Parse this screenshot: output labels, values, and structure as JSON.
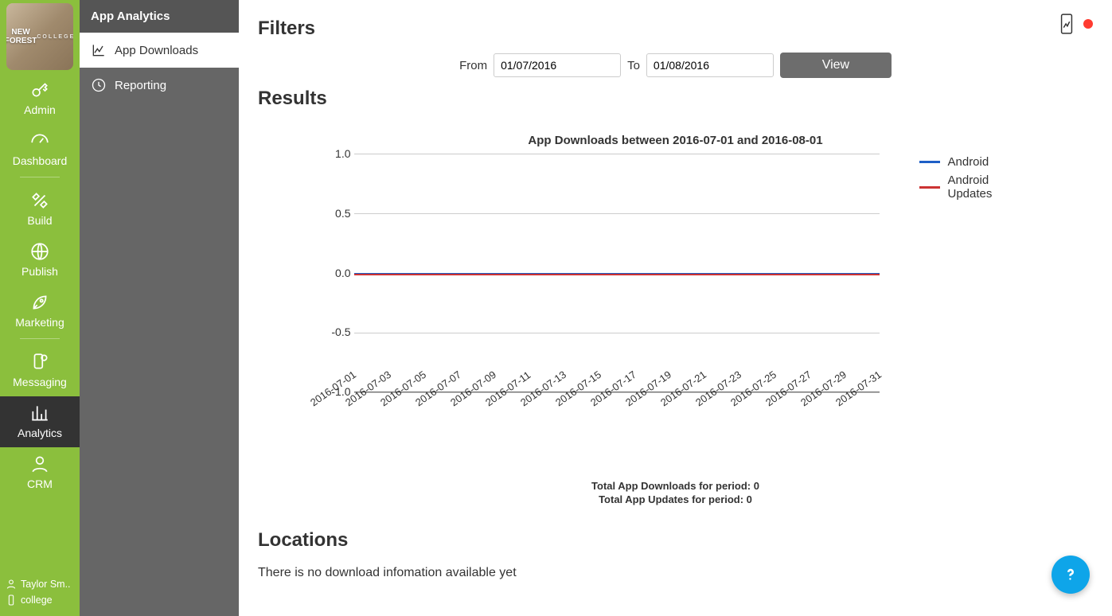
{
  "brand": {
    "line1": "NEW FOREST",
    "line2": "COLLEGE"
  },
  "nav": {
    "admin": "Admin",
    "dashboard": "Dashboard",
    "build": "Build",
    "publish": "Publish",
    "marketing": "Marketing",
    "messaging": "Messaging",
    "analytics": "Analytics",
    "crm": "CRM"
  },
  "footer": {
    "user": "Taylor Sm..",
    "channel": "college"
  },
  "secondary": {
    "title": "App Analytics",
    "app_downloads": "App Downloads",
    "reporting": "Reporting"
  },
  "filters": {
    "heading": "Filters",
    "from_label": "From",
    "to_label": "To",
    "from_value": "01/07/2016",
    "to_value": "01/08/2016",
    "view_label": "View"
  },
  "results": {
    "heading": "Results"
  },
  "locations": {
    "heading": "Locations",
    "empty": "There is no download infomation available yet"
  },
  "totals": {
    "downloads": "Total App Downloads for period: 0",
    "updates": "Total App Updates for period: 0"
  },
  "legend": {
    "android": "Android",
    "android_updates": "Android Updates"
  },
  "colors": {
    "accent": "#8bbf3d",
    "series_android": "#1e5fc6",
    "series_updates": "#c33",
    "help": "#0ea5e9",
    "status_dot": "#ff3b30"
  },
  "chart_data": {
    "type": "line",
    "title": "App Downloads between 2016-07-01 and 2016-08-01",
    "xlabel": "",
    "ylabel": "",
    "ylim": [
      -1.0,
      1.0
    ],
    "yticks": [
      -1.0,
      -0.5,
      0.0,
      0.5,
      1.0
    ],
    "categories": [
      "2016-07-01",
      "2016-07-03",
      "2016-07-05",
      "2016-07-07",
      "2016-07-09",
      "2016-07-11",
      "2016-07-13",
      "2016-07-15",
      "2016-07-17",
      "2016-07-19",
      "2016-07-21",
      "2016-07-23",
      "2016-07-25",
      "2016-07-27",
      "2016-07-29",
      "2016-07-31"
    ],
    "series": [
      {
        "name": "Android",
        "values": [
          0,
          0,
          0,
          0,
          0,
          0,
          0,
          0,
          0,
          0,
          0,
          0,
          0,
          0,
          0,
          0
        ]
      },
      {
        "name": "Android Updates",
        "values": [
          0,
          0,
          0,
          0,
          0,
          0,
          0,
          0,
          0,
          0,
          0,
          0,
          0,
          0,
          0,
          0
        ]
      }
    ]
  }
}
